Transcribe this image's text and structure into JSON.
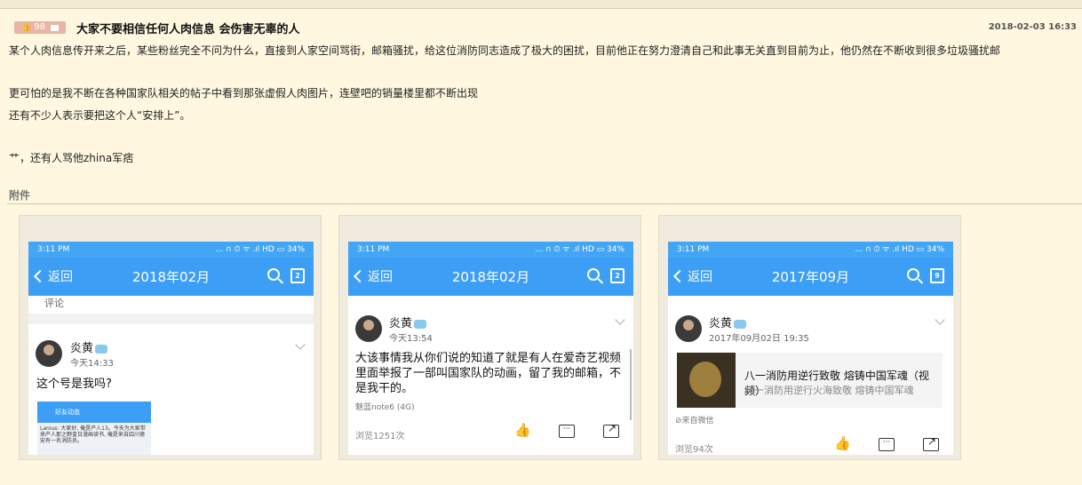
{
  "post": {
    "votes": "98",
    "title": "大家不要相信任何人肉信息 会伤害无辜的人",
    "date": "2018-02-03 16:33",
    "lines": [
      "某个人肉信息传开来之后，某些粉丝完全不问为什么，直接到人家空间骂街，邮箱骚扰，给这位消防同志造成了极大的困扰，目前他正在努力澄清自己和此事无关直到目前为止，他仍然在不断收到很多垃圾骚扰邮",
      "更可怕的是我不断在各种国家队相关的帖子中看到那张虚假人肉图片，连壁吧的销量楼里都不断出现",
      "还有不少人表示要把这个人“安排上”。",
      "艹，还有人骂他zhina军痞"
    ]
  },
  "attachments": {
    "label": "附件",
    "screenshots": [
      {
        "status_time": "3:11 PM",
        "status_icons": "... ∩ ⏱ ᯤ .ıl HD ▭ 34%",
        "back": "返回",
        "month": "2018年02月",
        "cal_num": "2",
        "top_text": "评论",
        "user": "炎黄",
        "time": "今天14:33",
        "content": [
          "这个号是我吗?"
        ],
        "mini_bar": "好友动态",
        "mini_text": "Lanius: 大家好, 俺是产人13。今天为大家带来产人那之野皇日漫画读书, 俺是来自四川德安有一名消防员。"
      },
      {
        "status_time": "3:11 PM",
        "status_icons": "... ∩ ⏱ ᯤ .ıl HD ▭ 34%",
        "back": "返回",
        "month": "2018年02月",
        "cal_num": "2",
        "user": "炎黄",
        "time": "今天13:54",
        "content": [
          "大该事情我从你们说的知道了就是有人在爱奇艺视频",
          "里面举报了一部叫国家队的动画，留了我的邮箱，不",
          "是我干的。"
        ],
        "device": "魅蓝note6 (4G)",
        "views": "浏览1251次"
      },
      {
        "status_time": "3:11 PM",
        "status_icons": "... ∩ ⏱ ᯤ .ıl HD ▭ 34%",
        "back": "返回",
        "month": "2017年09月",
        "cal_num": "9",
        "user": "炎黄",
        "time": "2017年09月02日 19:35",
        "link_title": "八一消防用逆行致敬  熔铸中国军魂（视频）",
        "link_sub": "八一消防用逆行火海致敬 熔铸中国军魂",
        "source": "来自微信",
        "views": "浏览94次"
      }
    ]
  },
  "colors": {
    "background": "#fff7e0",
    "phone_blue": "#3d9ef5",
    "badge": "#e8b6a4"
  }
}
